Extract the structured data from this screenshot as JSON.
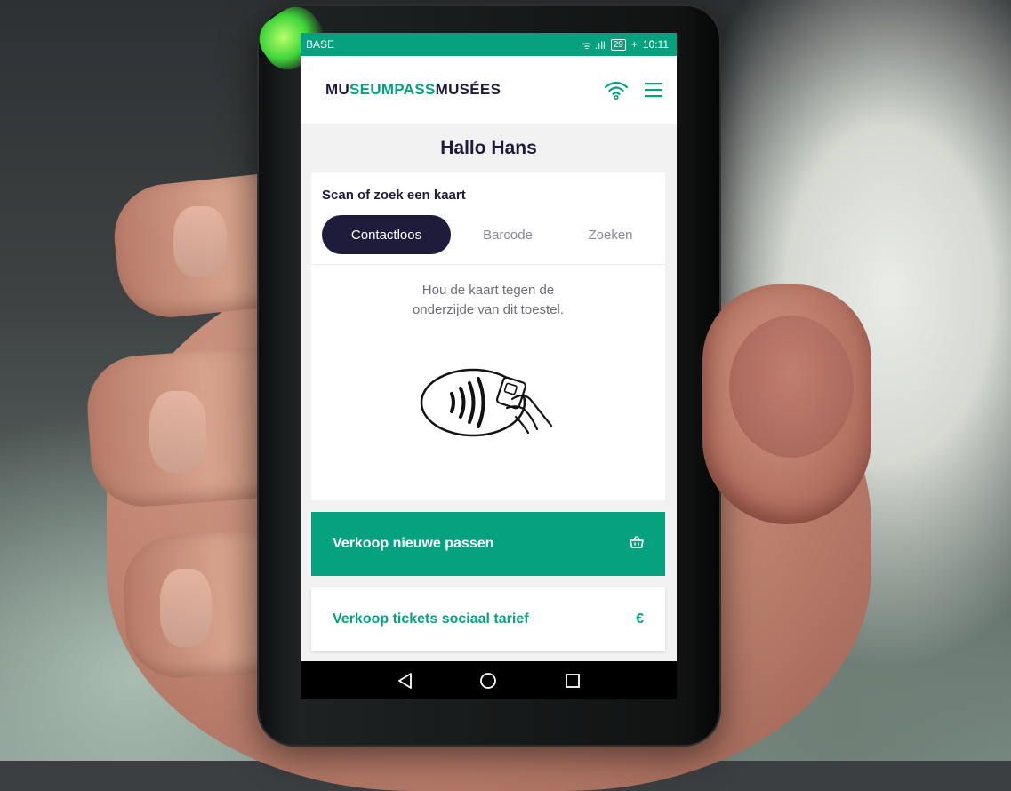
{
  "status_bar": {
    "carrier": "BASE",
    "signal_icons": "ᯤ .ıll",
    "battery": "29",
    "battery_suffix": "+",
    "time": "10:11"
  },
  "app_bar": {
    "logo_parts": [
      "MU",
      "SEUM",
      "PASS",
      "MUSÉES"
    ],
    "wifi_icon": "wifi-icon",
    "menu_icon": "hamburger-menu-icon"
  },
  "greeting": "Hallo Hans",
  "scan": {
    "title": "Scan of zoek een kaart",
    "tabs": [
      {
        "label": "Contactloos",
        "active": true
      },
      {
        "label": "Barcode",
        "active": false
      },
      {
        "label": "Zoeken",
        "active": false
      }
    ],
    "instruction_line1": "Hou de kaart tegen de",
    "instruction_line2": "onderzijde van dit toestel.",
    "illustration": "contactless-card-icon"
  },
  "actions": {
    "sell_passes": {
      "label": "Verkoop nieuwe passen",
      "icon": "basket-icon"
    },
    "sell_social": {
      "label": "Verkoop tickets sociaal tarief",
      "icon": "euro-icon",
      "icon_glyph": "€"
    }
  },
  "colors": {
    "brand_green": "#06a27f",
    "brand_dark": "#1f1b3a"
  },
  "nav": [
    "back-icon",
    "home-icon",
    "recents-icon"
  ]
}
